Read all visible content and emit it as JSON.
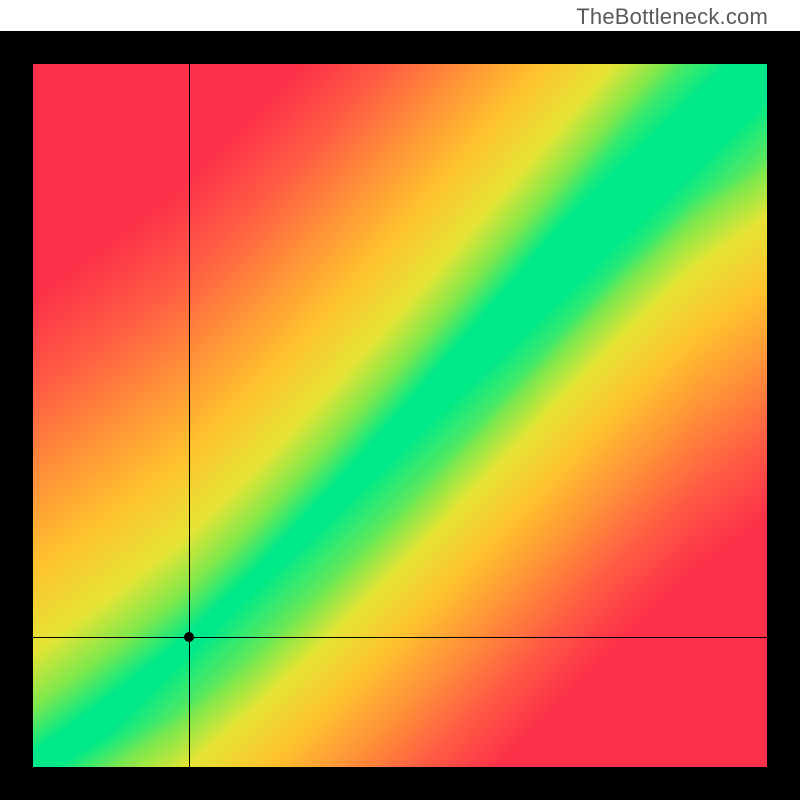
{
  "watermark": "TheBottleneck.com",
  "chart_data": {
    "type": "heatmap",
    "title": "",
    "xlabel": "",
    "ylabel": "",
    "xlim": [
      0,
      1
    ],
    "ylim": [
      0,
      1
    ],
    "grid": false,
    "legend": false,
    "marker": {
      "x": 0.213,
      "y": 0.185
    },
    "crosshair": {
      "x": 0.213,
      "y": 0.185
    },
    "optimal_band": {
      "description": "diagonal green band of optimal match; distance from band grades green→yellow→orange→red",
      "center_curve": [
        {
          "x": 0.0,
          "y": 0.0
        },
        {
          "x": 0.1,
          "y": 0.07
        },
        {
          "x": 0.2,
          "y": 0.145
        },
        {
          "x": 0.3,
          "y": 0.24
        },
        {
          "x": 0.4,
          "y": 0.345
        },
        {
          "x": 0.5,
          "y": 0.455
        },
        {
          "x": 0.6,
          "y": 0.57
        },
        {
          "x": 0.7,
          "y": 0.685
        },
        {
          "x": 0.8,
          "y": 0.8
        },
        {
          "x": 0.9,
          "y": 0.905
        },
        {
          "x": 1.0,
          "y": 0.985
        }
      ],
      "band_half_width": 0.055
    },
    "color_scale": [
      {
        "stop": 0.0,
        "color": "#00e989"
      },
      {
        "stop": 0.1,
        "color": "#7ee84d"
      },
      {
        "stop": 0.22,
        "color": "#e6e435"
      },
      {
        "stop": 0.4,
        "color": "#ffc22e"
      },
      {
        "stop": 0.6,
        "color": "#ff8f39"
      },
      {
        "stop": 0.8,
        "color": "#ff5a44"
      },
      {
        "stop": 1.0,
        "color": "#fc3049"
      }
    ]
  }
}
